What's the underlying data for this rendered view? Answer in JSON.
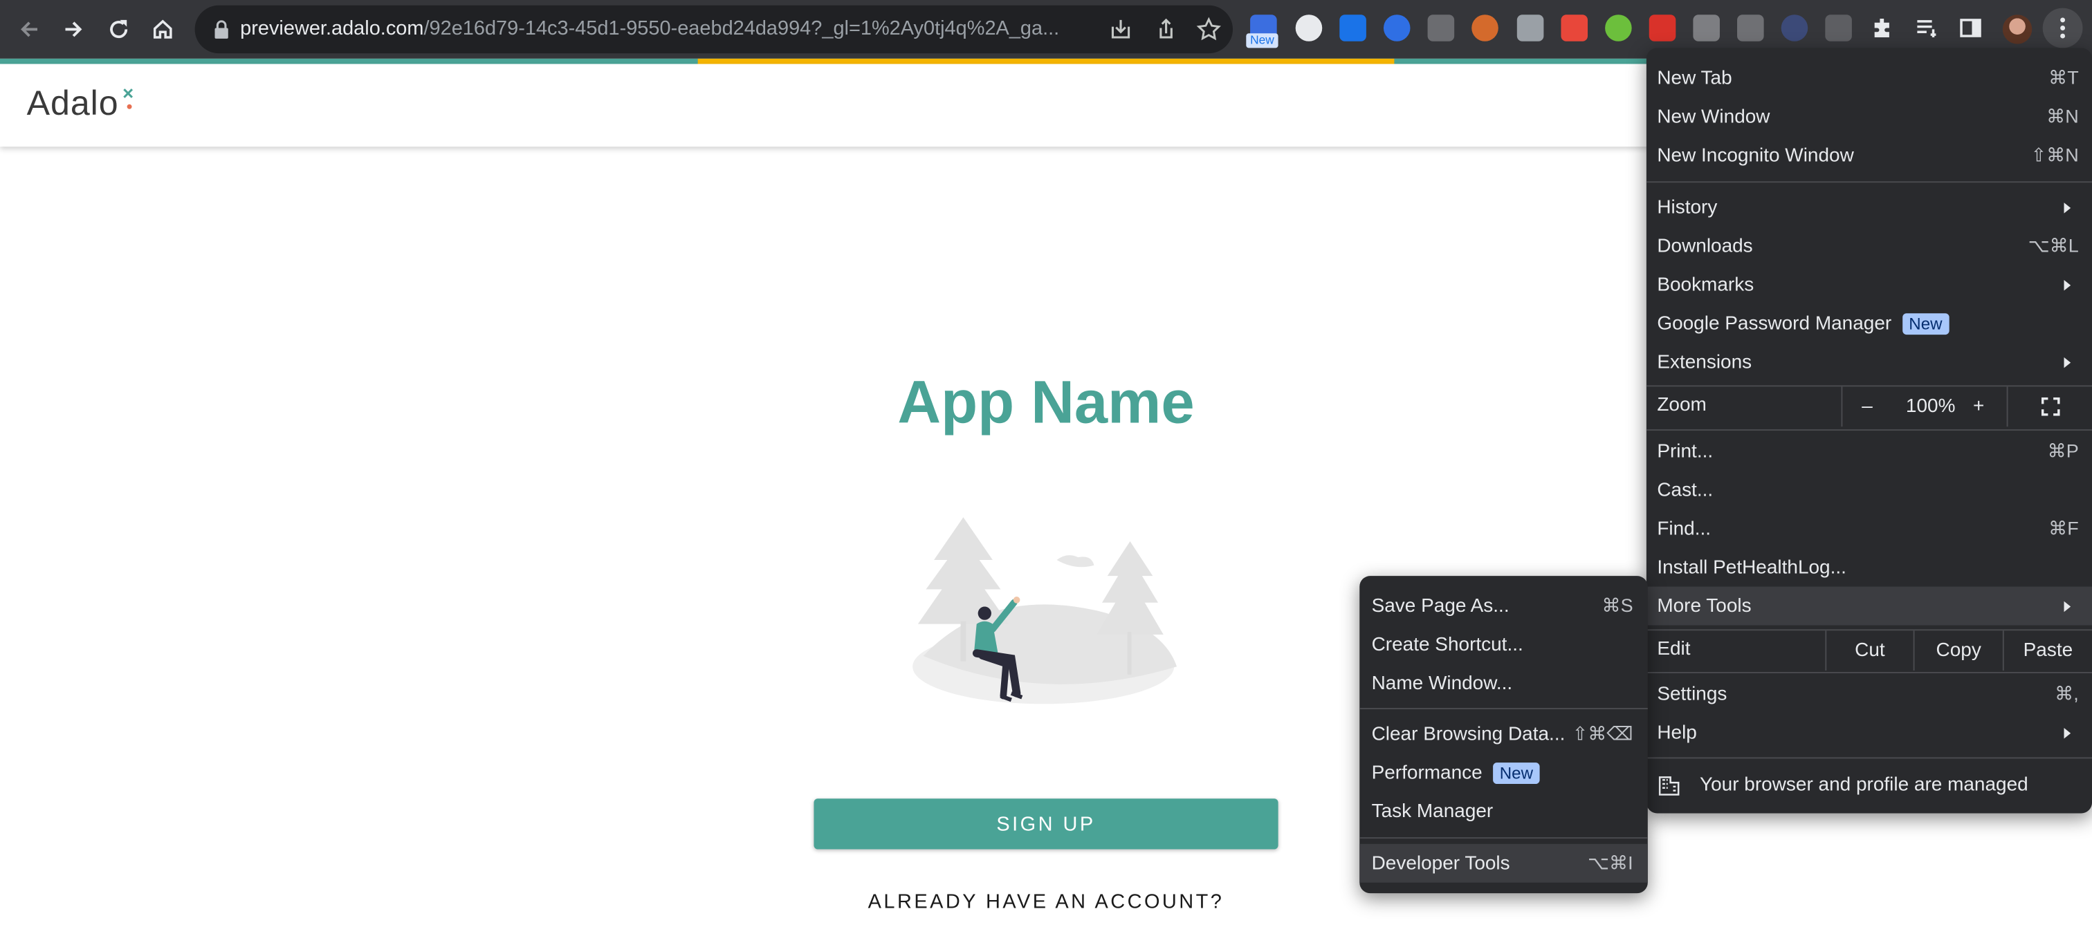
{
  "browser": {
    "url_host": "previewer.adalo.com",
    "url_path": "/92e16d79-14c3-45d1-9550-eaebd24da994?_gl=1%2Ay0tj4q%2A_ga...",
    "ext_badge_new": "New"
  },
  "page": {
    "logo_text": "Adalo",
    "app_name": "App Name",
    "signup_label": "SIGN UP",
    "login_label": "ALREADY HAVE AN ACCOUNT?",
    "accent_color": "#4aa396"
  },
  "menu": {
    "new_tab": {
      "label": "New Tab",
      "shortcut": "⌘T"
    },
    "new_window": {
      "label": "New Window",
      "shortcut": "⌘N"
    },
    "new_incognito": {
      "label": "New Incognito Window",
      "shortcut": "⇧⌘N"
    },
    "history": {
      "label": "History"
    },
    "downloads": {
      "label": "Downloads",
      "shortcut": "⌥⌘L"
    },
    "bookmarks": {
      "label": "Bookmarks"
    },
    "password_manager": {
      "label": "Google Password Manager",
      "badge": "New"
    },
    "extensions": {
      "label": "Extensions"
    },
    "zoom": {
      "label": "Zoom",
      "minus": "–",
      "value": "100%",
      "plus": "+"
    },
    "print": {
      "label": "Print...",
      "shortcut": "⌘P"
    },
    "cast": {
      "label": "Cast..."
    },
    "find": {
      "label": "Find...",
      "shortcut": "⌘F"
    },
    "install": {
      "label": "Install PetHealthLog..."
    },
    "more_tools": {
      "label": "More Tools"
    },
    "edit": {
      "label": "Edit",
      "cut": "Cut",
      "copy": "Copy",
      "paste": "Paste"
    },
    "settings": {
      "label": "Settings",
      "shortcut": "⌘,"
    },
    "help": {
      "label": "Help"
    },
    "managed": {
      "label": "Your browser and profile are managed"
    }
  },
  "submenu": {
    "save_page": {
      "label": "Save Page As...",
      "shortcut": "⌘S"
    },
    "create_shortcut": {
      "label": "Create Shortcut..."
    },
    "name_window": {
      "label": "Name Window..."
    },
    "clear_data": {
      "label": "Clear Browsing Data...",
      "shortcut": "⇧⌘⌫"
    },
    "performance": {
      "label": "Performance",
      "badge": "New"
    },
    "task_manager": {
      "label": "Task Manager"
    },
    "dev_tools": {
      "label": "Developer Tools",
      "shortcut": "⌥⌘I"
    }
  }
}
